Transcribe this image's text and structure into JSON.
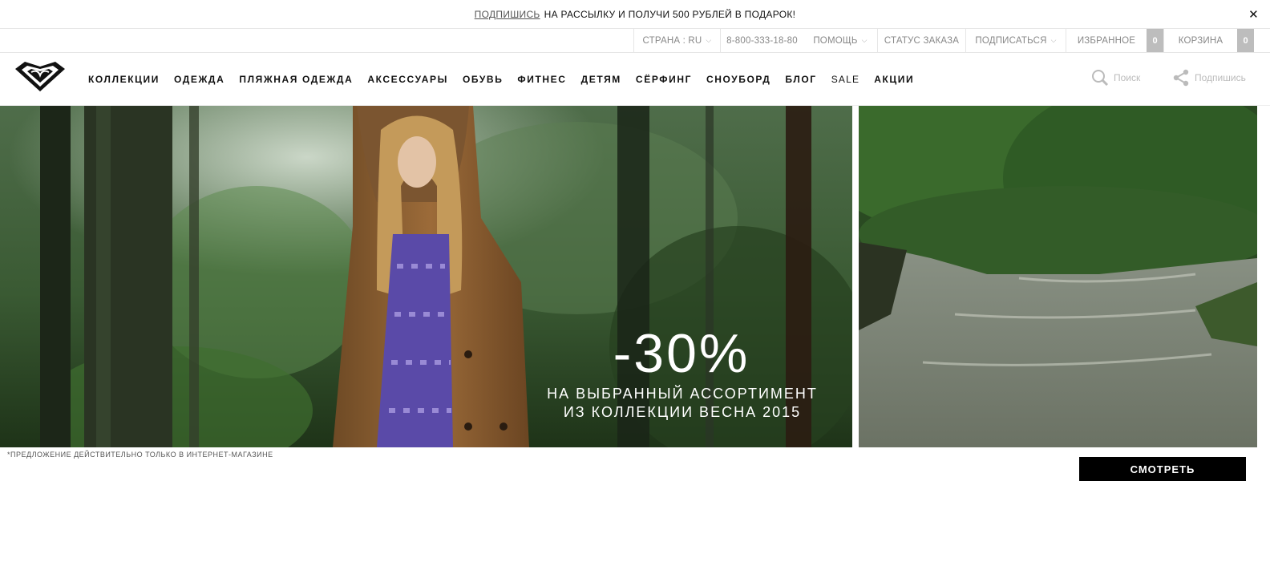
{
  "promo": {
    "link": "ПОДПИШИСЬ",
    "text": "НА РАССЫЛКУ И ПОЛУЧИ 500 РУБЛЕЙ В ПОДАРОК!",
    "close": "✕"
  },
  "utility": {
    "country": "СТРАНА : RU",
    "phone": "8-800-333-18-80",
    "help": "ПОМОЩЬ",
    "order_status": "СТАТУС ЗАКАЗА",
    "subscribe": "ПОДПИСАТЬСЯ",
    "favorites": "ИЗБРАННОЕ",
    "favorites_count": "0",
    "cart": "КОРЗИНА",
    "cart_count": "0"
  },
  "nav": {
    "items": [
      "КОЛЛЕКЦИИ",
      "ОДЕЖДА",
      "ПЛЯЖНАЯ ОДЕЖДА",
      "АКСЕССУАРЫ",
      "ОБУВЬ",
      "ФИТНЕС",
      "ДЕТЯМ",
      "СЁРФИНГ",
      "СНОУБОРД",
      "БЛОГ",
      "SALE",
      "АКЦИИ"
    ],
    "search": "Поиск",
    "share": "Подпишись"
  },
  "hero": {
    "headline": "-30%",
    "sub_line1": "НА ВЫБРАННЫЙ АССОРТИМЕНТ",
    "sub_line2": "ИЗ КОЛЛЕКЦИИ ВЕСНА 2015"
  },
  "disclaimer": "*ПРЕДЛОЖЕНИЕ ДЕЙСТВИТЕЛЬНО ТОЛЬКО В ИНТЕРНЕТ-МАГАЗИНЕ",
  "cta": "СМОТРЕТЬ",
  "icons": {
    "logo": "roxy-heart-logo",
    "search": "search-icon",
    "share": "share-icon",
    "chevron": "chevron-down-icon",
    "close": "close-icon"
  }
}
